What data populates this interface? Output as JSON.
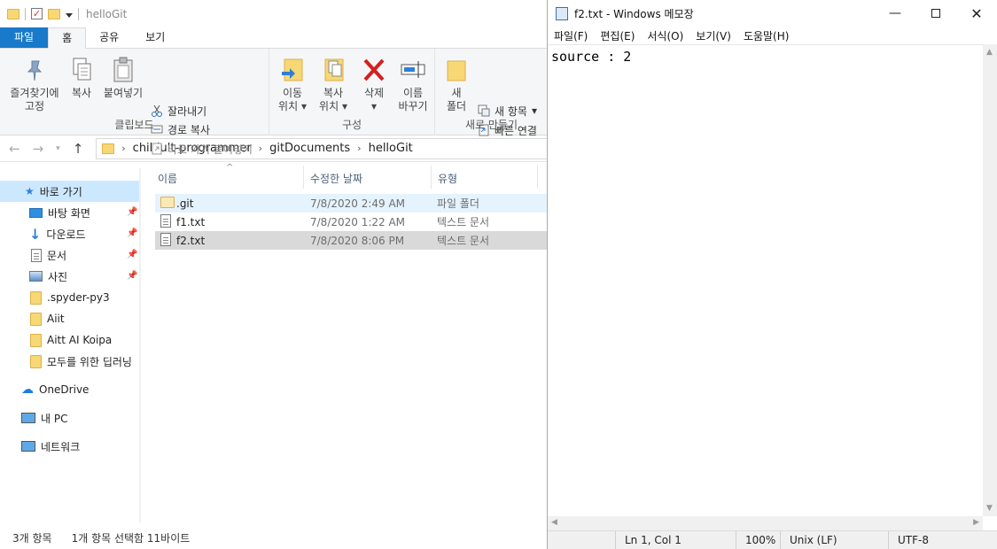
{
  "explorer": {
    "title": "helloGit",
    "tabs": [
      "파일",
      "홈",
      "공유",
      "보기"
    ],
    "ribbon": {
      "clipboard": {
        "pin_label_1": "즐겨찾기에",
        "pin_label_2": "고정",
        "copy_label": "복사",
        "paste_label": "붙여넣기",
        "cut_label": "잘라내기",
        "copy_path_label": "경로 복사",
        "paste_shortcut_label": "바로 가기 붙여넣기",
        "group_label": "클립보드"
      },
      "organize": {
        "move_label_1": "이동",
        "move_label_2": "위치",
        "copyto_label_1": "복사",
        "copyto_label_2": "위치",
        "delete_label": "삭제",
        "rename_label_1": "이름",
        "rename_label_2": "바꾸기",
        "group_label": "구성"
      },
      "new": {
        "new_folder_label_1": "새",
        "new_folder_label_2": "폴더",
        "new_item_label": "새 항목",
        "easy_access_label": "빠른 연결",
        "group_label": "새로 만들기"
      }
    },
    "breadcrumb": [
      "childult-programmer",
      "gitDocuments",
      "helloGit"
    ],
    "nav": {
      "quick_access": "바로 가기",
      "desktop": "바탕 화면",
      "downloads": "다운로드",
      "documents": "문서",
      "pictures": "사진",
      "spyder": ".spyder-py3",
      "aiit": "Aiit",
      "aitt": "Aitt AI Koipa",
      "deeplearning": "모두를 위한 딥러닝",
      "onedrive": "OneDrive",
      "thispc": "내 PC",
      "network": "네트워크"
    },
    "columns": {
      "name": "이름",
      "date": "수정한 날짜",
      "type": "유형"
    },
    "files": [
      {
        "name": ".git",
        "date": "7/8/2020 2:49 AM",
        "type": "파일 폴더"
      },
      {
        "name": "f1.txt",
        "date": "7/8/2020 1:22 AM",
        "type": "텍스트 문서"
      },
      {
        "name": "f2.txt",
        "date": "7/8/2020 8:06 PM",
        "type": "텍스트 문서"
      }
    ],
    "status": {
      "count": "3개 항목",
      "selection": "1개 항목 선택함 11바이트"
    }
  },
  "notepad": {
    "title": "f2.txt - Windows 메모장",
    "menu": [
      "파일(F)",
      "편집(E)",
      "서식(O)",
      "보기(V)",
      "도움말(H)"
    ],
    "content": "source : 2",
    "status": {
      "position": "Ln 1, Col 1",
      "zoom": "100%",
      "eol": "Unix (LF)",
      "encoding": "UTF-8"
    }
  }
}
